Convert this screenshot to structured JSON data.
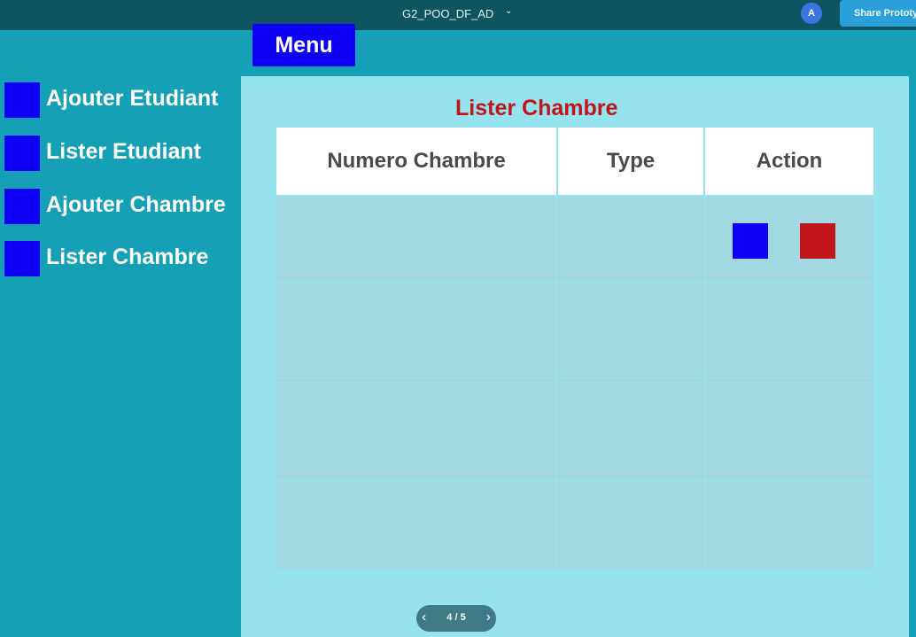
{
  "topbar": {
    "project_title": "G2_POO_DF_AD",
    "avatar_initial": "A",
    "share_label": "Share Prototype"
  },
  "menu_label": "Menu",
  "sidebar": {
    "items": [
      {
        "label": "Ajouter Etudiant"
      },
      {
        "label": "Lister Etudiant"
      },
      {
        "label": "Ajouter Chambre"
      },
      {
        "label": "Lister Chambre"
      }
    ]
  },
  "main": {
    "title": "Lister Chambre",
    "table": {
      "headers": [
        "Numero Chambre",
        "Type",
        "Action"
      ],
      "rows": [
        {
          "numero": "",
          "type": ""
        },
        {
          "numero": "",
          "type": ""
        },
        {
          "numero": "",
          "type": ""
        },
        {
          "numero": "",
          "type": ""
        }
      ]
    }
  },
  "pager": {
    "page_label": "4 / 5"
  },
  "colors": {
    "accent_blue": "#0d00f5",
    "accent_red": "#c0161b",
    "sidebar_bg": "#16a0b5",
    "main_bg": "#96e2ef",
    "topbar_bg": "#0e5561"
  },
  "icons": [
    "chevron-down-icon",
    "chevron-left-icon",
    "chevron-right-icon"
  ]
}
